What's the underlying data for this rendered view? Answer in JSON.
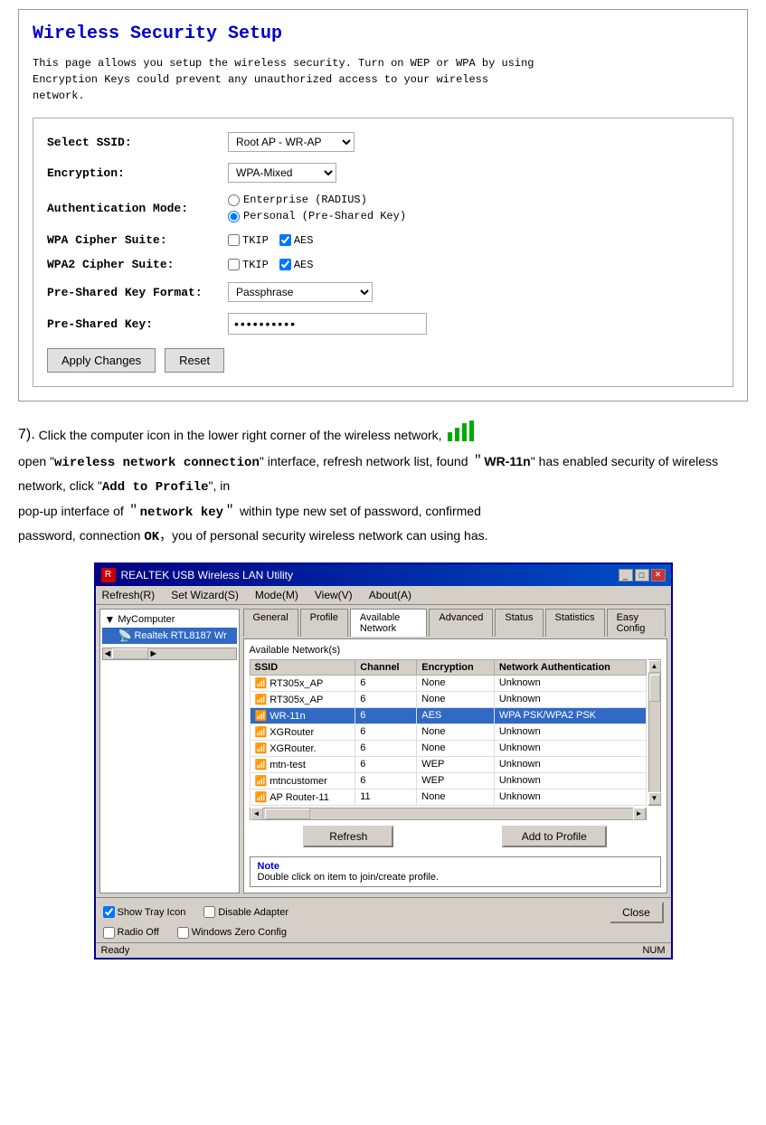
{
  "topSection": {
    "title": "Wireless Security Setup",
    "description": "This page allows you setup the wireless security.  Turn on WEP or WPA by using\nEncryption Keys could prevent  any unauthorized access to your wireless\nnetwork.",
    "selectSsidLabel": "Select SSID:",
    "ssidOptions": [
      "Root AP - WR-AP"
    ],
    "ssidSelected": "Root AP - WR-AP",
    "encryptionLabel": "Encryption:",
    "encryptionOptions": [
      "WPA-Mixed"
    ],
    "encryptionSelected": "WPA-Mixed",
    "authModeLabel": "Authentication Mode:",
    "authOptions": [
      "Enterprise (RADIUS)",
      "Personal (Pre-Shared Key)"
    ],
    "authSelected": "Personal (Pre-Shared Key)",
    "wpaCipherLabel": "WPA Cipher Suite:",
    "wpa2CipherLabel": "WPA2 Cipher Suite:",
    "tkipLabel": "TKIP",
    "aesLabel": "AES",
    "presharedKeyFormatLabel": "Pre-Shared Key Format:",
    "formatOptions": [
      "Passphrase"
    ],
    "formatSelected": "Passphrase",
    "presharedKeyLabel": "Pre-Shared Key:",
    "keyValue": "••••••••••",
    "applyButton": "Apply Changes",
    "resetButton": "Reset"
  },
  "middleText": {
    "step": "7).",
    "text1": "Click the computer icon in the lower right corner of the wireless network,",
    "text2": "open \"",
    "text2mono": "wireless network connection",
    "text2end": "\" interface,  refresh network list,  found ＂",
    "text3bold": "WR-11n",
    "text3end": "\" has  enabled  security  of  wireless  network,  click \"",
    "text3mono": "Add to Profile",
    "text3end2": "\",  in",
    "text4": "pop-up interface of ＂",
    "text4mono": "network key",
    "text4end": "＂ within  type new set of password,  confirmed",
    "text5": "password,  connection",
    "text5mono": "OK",
    "text5end": "，you of personal security wireless network can using has."
  },
  "utility": {
    "titleBarText": "REALTEK USB Wireless LAN Utility",
    "menuItems": [
      "Refresh(R)",
      "Set Wizard(S)",
      "Mode(M)",
      "View(V)",
      "About(A)"
    ],
    "tabs": [
      "General",
      "Profile",
      "Available Network",
      "Advanced",
      "Status",
      "Statistics",
      "Easy Config"
    ],
    "activeTab": "Available Network",
    "networkLabel": "Available Network(s)",
    "tableHeaders": [
      "SSID",
      "Channel",
      "Encryption",
      "Network Authentication"
    ],
    "tableRows": [
      {
        "ssid": "RT305x_AP",
        "channel": "6",
        "encryption": "None",
        "auth": "Unknown",
        "icon": "📶"
      },
      {
        "ssid": "RT305x_AP",
        "channel": "6",
        "encryption": "None",
        "auth": "Unknown",
        "icon": "📶"
      },
      {
        "ssid": "WR-11n",
        "channel": "6",
        "encryption": "AES",
        "auth": "WPA PSK/WPA2 PSK",
        "icon": "📶",
        "highlighted": true
      },
      {
        "ssid": "XGRouter",
        "channel": "6",
        "encryption": "None",
        "auth": "Unknown",
        "icon": "📶"
      },
      {
        "ssid": "XGRouter.",
        "channel": "6",
        "encryption": "None",
        "auth": "Unknown",
        "icon": "📶"
      },
      {
        "ssid": "mtn-test",
        "channel": "6",
        "encryption": "WEP",
        "auth": "Unknown",
        "icon": "📶"
      },
      {
        "ssid": "mtncustomer",
        "channel": "6",
        "encryption": "WEP",
        "auth": "Unknown",
        "icon": "📶"
      },
      {
        "ssid": "AP Router-11",
        "channel": "11",
        "encryption": "None",
        "auth": "Unknown",
        "icon": "📶"
      }
    ],
    "refreshButton": "Refresh",
    "addToProfileButton": "Add to Profile",
    "noteTitle": "Note",
    "noteText": "Double click on item to join/create profile.",
    "bottomChecks": [
      "Show Tray Icon",
      "Disable Adapter",
      "Windows Zero Config"
    ],
    "radioOff": "Radio Off",
    "closeButton": "Close",
    "statusText": "Ready",
    "statusRight": "NUM",
    "treeItems": [
      "MyComputer",
      "Realtek RTL8187 Wr"
    ],
    "scrollbarHLabel": ""
  }
}
